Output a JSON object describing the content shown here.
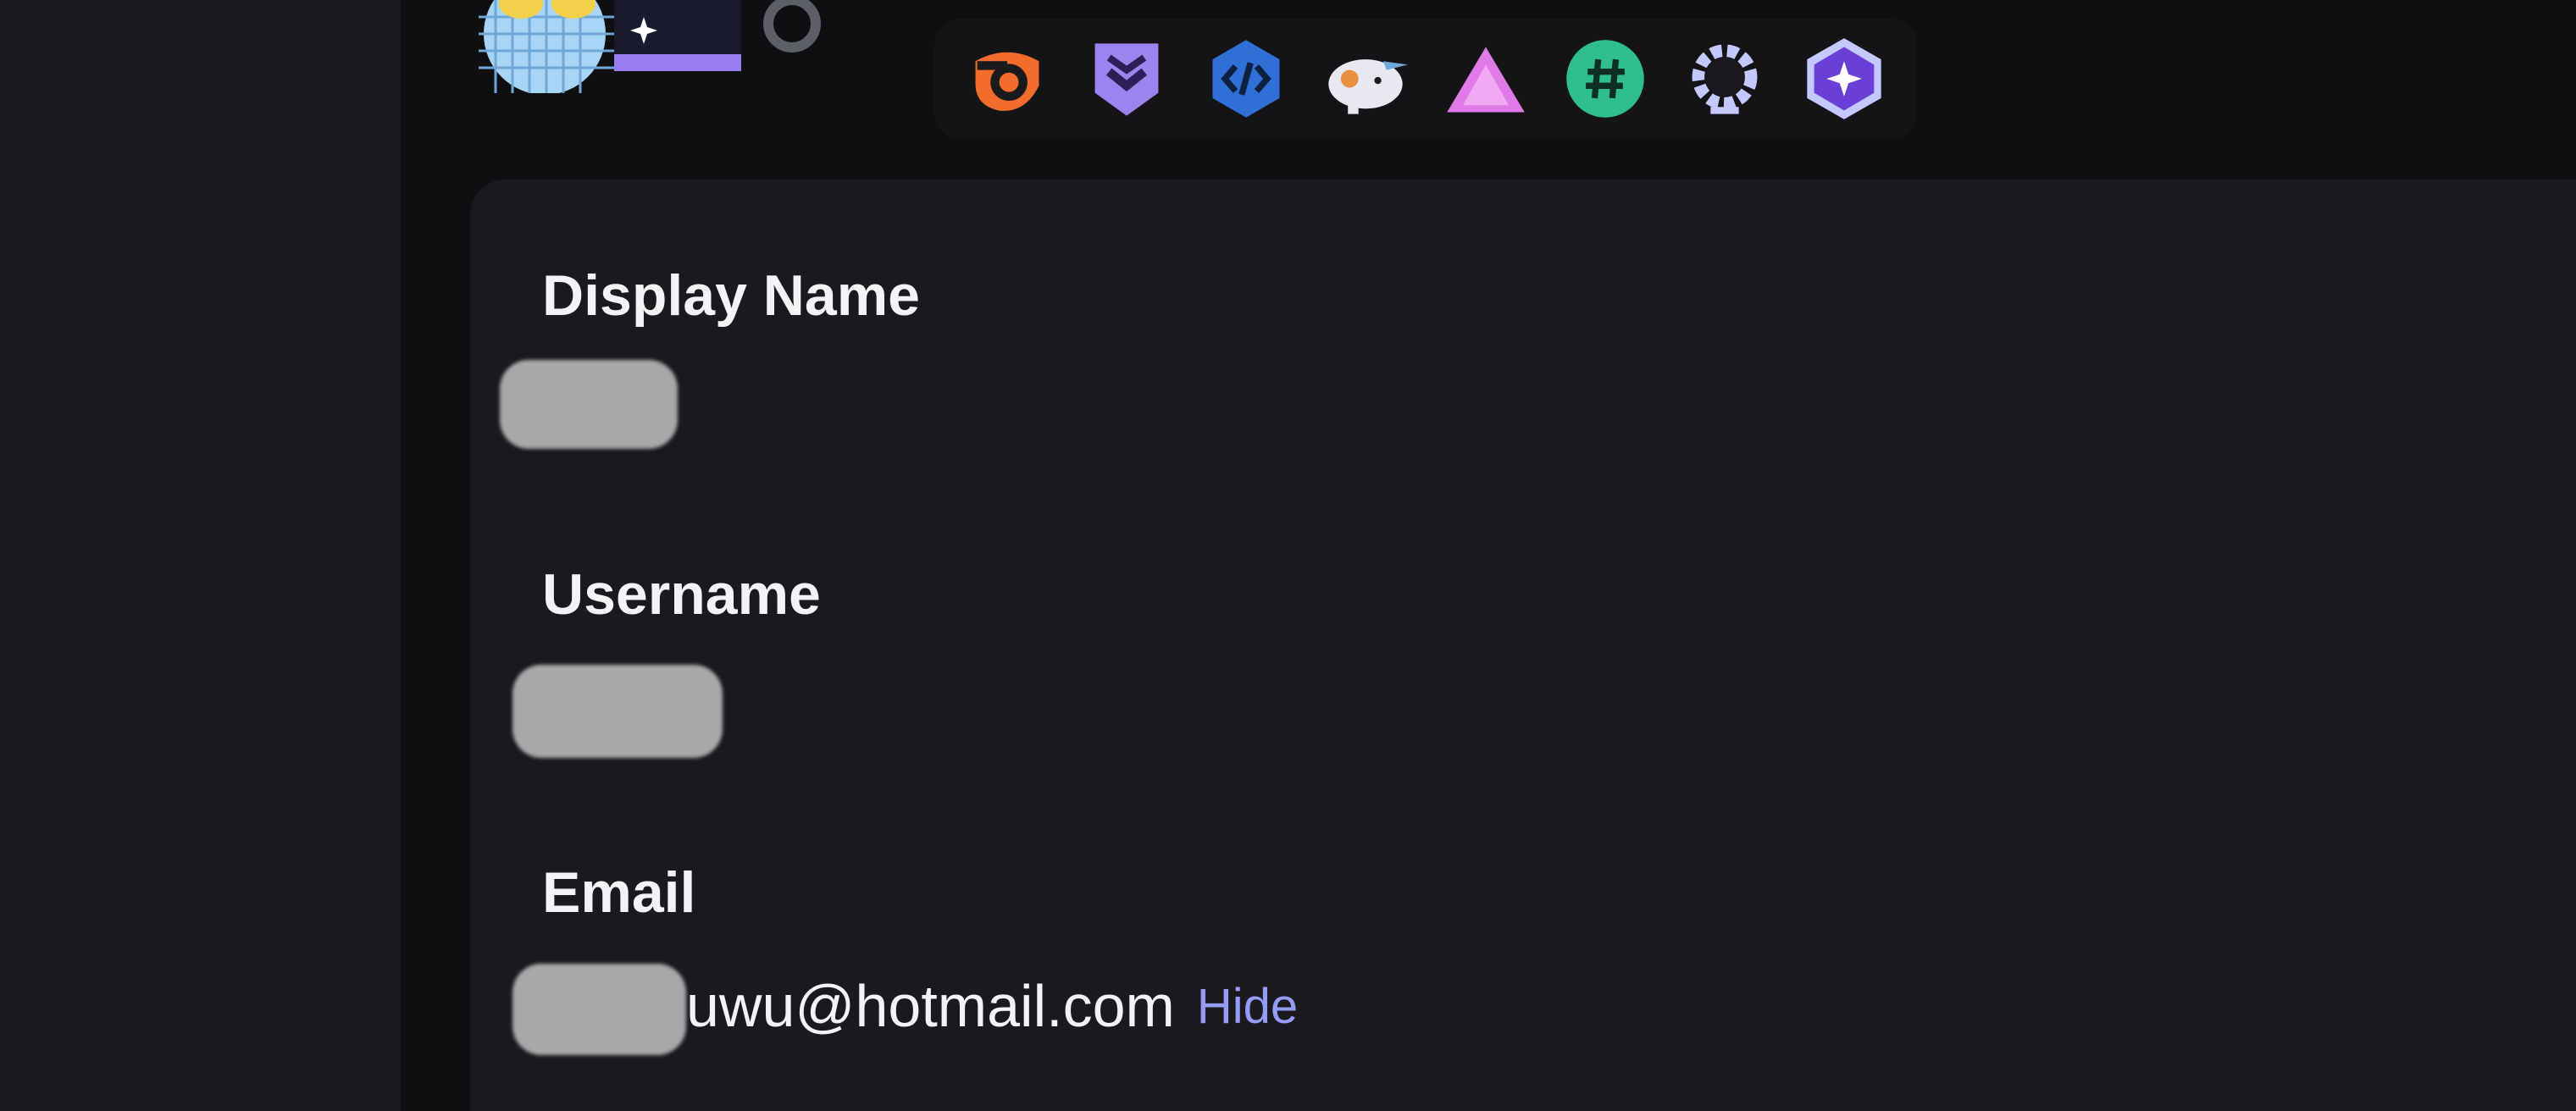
{
  "fields": {
    "display_name": {
      "label": "Display Name"
    },
    "username": {
      "label": "Username"
    },
    "email": {
      "label": "Email",
      "visible_suffix": "uwu@hotmail.com",
      "toggle_label": "Hide"
    }
  },
  "badges": [
    {
      "icon": "hypesquad-balance-icon",
      "color": "#f26c2c"
    },
    {
      "icon": "hypesquad-bravery-icon",
      "color": "#9c84ef"
    },
    {
      "icon": "active-developer-icon",
      "color": "#2f6fd6"
    },
    {
      "icon": "nitro-pet-icon",
      "color": "#e8e8f0"
    },
    {
      "icon": "triangle-badge-icon",
      "color": "#e07ae6"
    },
    {
      "icon": "hashtag-badge-icon",
      "color": "#2fbf8f"
    },
    {
      "icon": "laurel-badge-icon",
      "color": "#c3c8ff"
    },
    {
      "icon": "quest-badge-icon",
      "color": "#8a5cf6"
    }
  ],
  "colors": {
    "background": "#0f0f12",
    "sidebar": "#1a1a1e",
    "card": "#19191e",
    "text": "#f2f3f5",
    "link": "#949cf7"
  }
}
